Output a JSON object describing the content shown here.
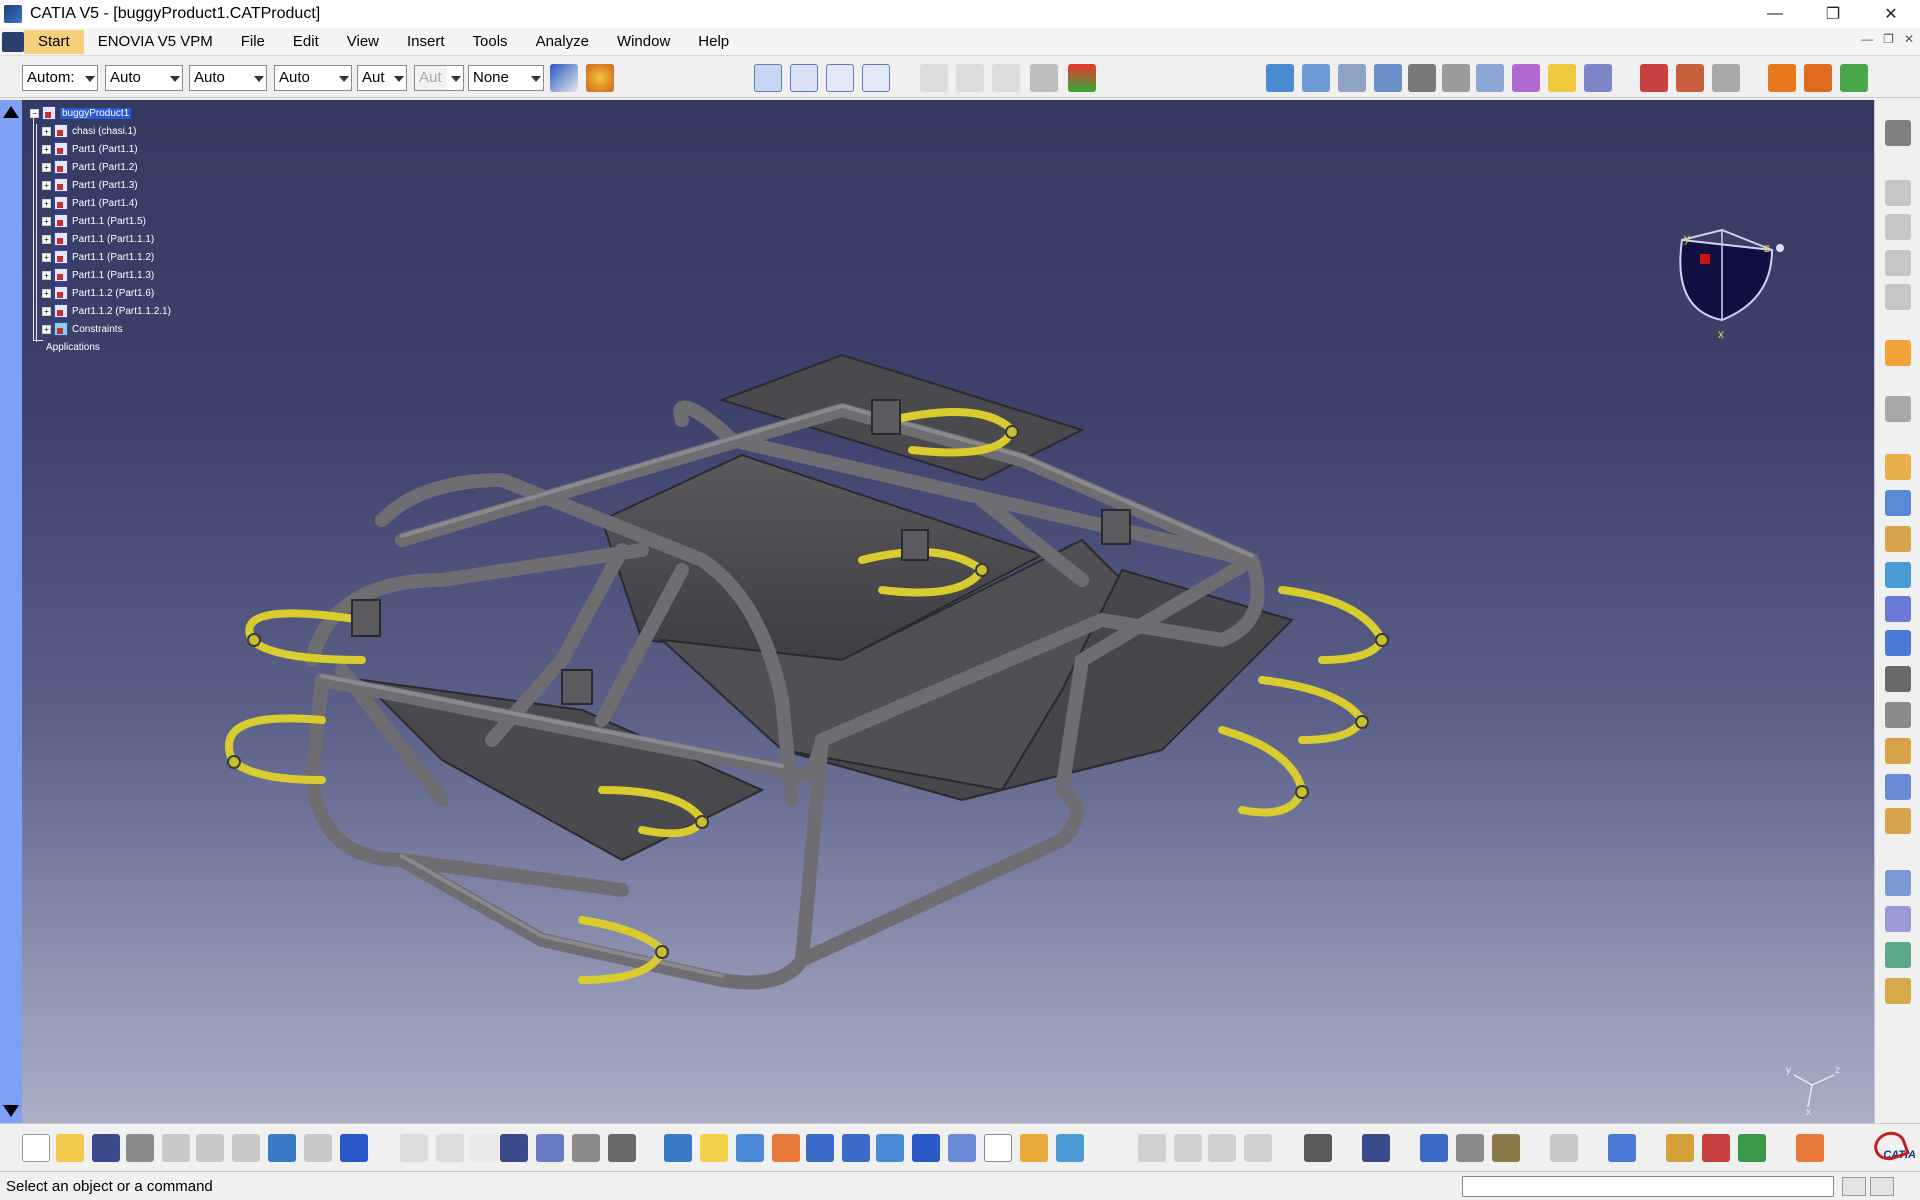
{
  "window": {
    "title": "CATIA V5 - [buggyProduct1.CATProduct]",
    "controls": [
      "minimize",
      "restore",
      "close"
    ]
  },
  "menubar": {
    "items": [
      {
        "label": "Start",
        "active": true
      },
      {
        "label": "ENOVIA V5 VPM",
        "active": false
      },
      {
        "label": "File",
        "active": false
      },
      {
        "label": "Edit",
        "active": false
      },
      {
        "label": "View",
        "active": false
      },
      {
        "label": "Insert",
        "active": false
      },
      {
        "label": "Tools",
        "active": false
      },
      {
        "label": "Analyze",
        "active": false
      },
      {
        "label": "Window",
        "active": false
      },
      {
        "label": "Help",
        "active": false
      }
    ]
  },
  "graphic_properties": {
    "combos": [
      "Autom:",
      "Auto",
      "Auto",
      "Auto",
      "Aut",
      "Aut",
      "None"
    ]
  },
  "tree": {
    "root": "buggyProduct1",
    "children": [
      "chasi (chasi.1)",
      "Part1 (Part1.1)",
      "Part1 (Part1.2)",
      "Part1 (Part1.3)",
      "Part1 (Part1.4)",
      "Part1.1 (Part1.5)",
      "Part1.1 (Part1.1.1)",
      "Part1.1 (Part1.1.2)",
      "Part1.1 (Part1.1.3)",
      "Part1.1.2 (Part1.6)",
      "Part1.1.2 (Part1.1.2.1)",
      "Constraints"
    ],
    "applications": "Applications"
  },
  "compass": {
    "labels": {
      "x": "x",
      "y": "y",
      "z": "z"
    }
  },
  "mini_axes": {
    "x": "x",
    "y": "y",
    "z": "z"
  },
  "status": {
    "message": "Select an object or a command"
  },
  "logo": {
    "text": "CATIA"
  },
  "colors": {
    "viewport_top": "#343a62",
    "viewport_bottom": "#aaaec6",
    "tube_gray": "#6e6e72",
    "tube_yellow": "#d8cc2e",
    "selection": "#2c57d6"
  }
}
